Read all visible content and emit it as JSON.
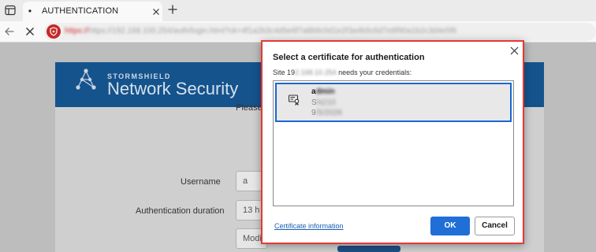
{
  "browser": {
    "tab": {
      "favicon_glyph": "•",
      "title": "AUTHENTICATION"
    },
    "url_masked": "https://192.168.100.254/auth/login.html?ck=4f1a2b3c4d5e6f7a8b9c0d1e2f3a4b5c6d7e8f90a1b2c3d4e5f6",
    "url_masked_prefix": "https://",
    "icons": {
      "tab_actions": "tab-actions-icon",
      "tab_close": "close-icon",
      "new_tab": "plus-icon",
      "back": "back-arrow-icon",
      "stop": "stop-icon",
      "security": "not-secure-shield-icon"
    }
  },
  "page": {
    "brand_top": "STORMSHIELD",
    "brand_main": "Network Security",
    "please_text": "Please",
    "username_label": "Username",
    "username_value": "a",
    "duration_label": "Authentication duration",
    "duration_value": "13 h",
    "modify_button": "Modif"
  },
  "dialog": {
    "title": "Select a certificate for authentication",
    "site_prefix": "Site 19",
    "site_masked": "2.168.10.254",
    "site_suffix": " needs your credentials:",
    "certificate": {
      "line1_visible": "a",
      "line1_masked": "dmin",
      "line2_visible": "S",
      "line2_masked": "N210",
      "line3_visible": "9",
      "line3_masked": "/5/2026"
    },
    "cert_info_link": "Certificate information",
    "ok_button": "OK",
    "cancel_button": "Cancel"
  },
  "colors": {
    "banner": "#15538d",
    "primary_button": "#1f6fd6",
    "highlight_border": "#e53935",
    "security_badge": "#c62828"
  }
}
